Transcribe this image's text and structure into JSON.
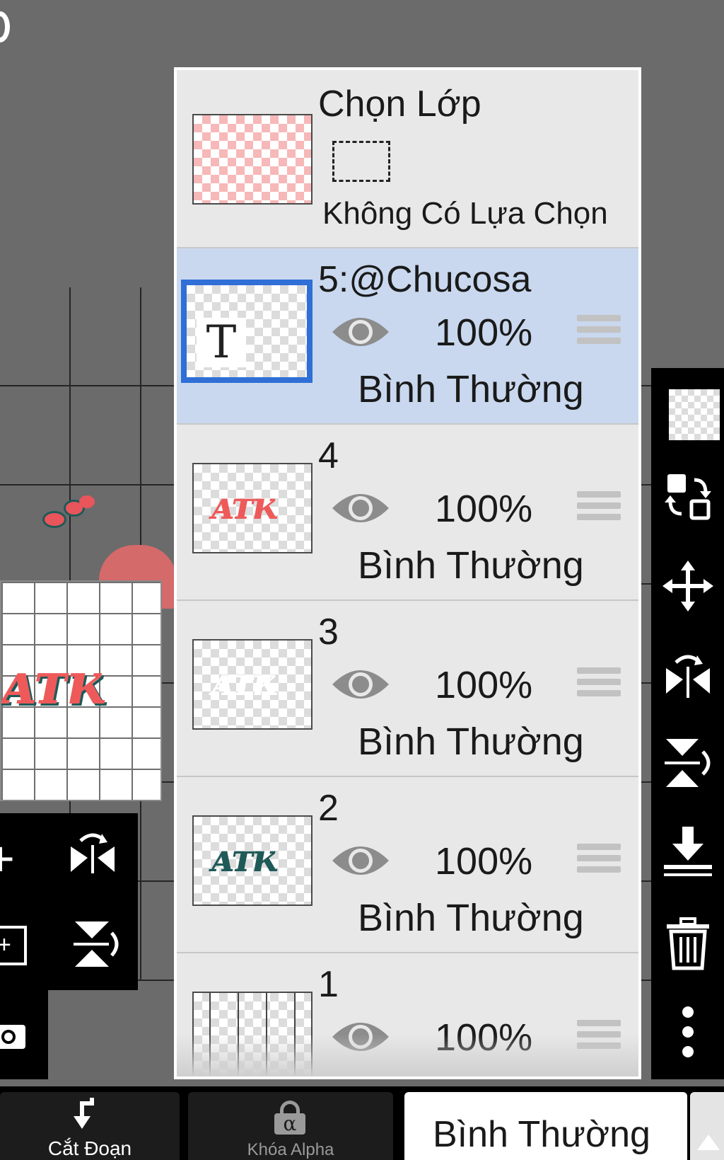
{
  "selection_header": {
    "title": "Chọn Lớp",
    "status": "Không Có Lựa Chọn"
  },
  "layers": [
    {
      "name": "5:@Chucosa",
      "opacity": "100%",
      "blend": "Bình Thường",
      "thumb_text": "T",
      "selected": true
    },
    {
      "name": "4",
      "opacity": "100%",
      "blend": "Bình Thường",
      "selected": false
    },
    {
      "name": "3",
      "opacity": "100%",
      "blend": "Bình Thường",
      "selected": false
    },
    {
      "name": "2",
      "opacity": "100%",
      "blend": "Bình Thường",
      "selected": false
    },
    {
      "name": "1",
      "opacity": "100%",
      "selected": false
    }
  ],
  "bottom_bar": {
    "clip_label": "Cắt Đoạn",
    "alpha_lock_label": "Khóa Alpha",
    "alpha_symbol": "α",
    "blend_mode": "Bình Thường"
  },
  "left_toolbar": {
    "add_symbol": "+"
  },
  "colors": {
    "panel_bg": "#e8e8e8",
    "selected_row": "#c9d8ee",
    "selection_border": "#2f6fd6",
    "pink_art": "#e8555a",
    "teal_art": "#1f5a58",
    "toolbar_bg": "#000000"
  }
}
